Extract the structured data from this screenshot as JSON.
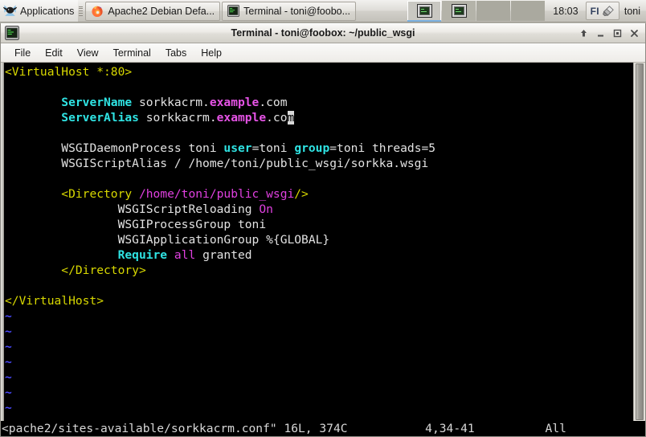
{
  "panel": {
    "apps_menu_label": "Applications",
    "tasks": [
      {
        "label": "Apache2 Debian Defa...",
        "icon": "firefox-icon"
      },
      {
        "label": "Terminal - toni@foobo...",
        "icon": "terminal-icon"
      }
    ],
    "workspaces": [
      {
        "name": "workspace-1",
        "active": true,
        "has_window": true
      },
      {
        "name": "workspace-2",
        "active": false,
        "has_window": true
      },
      {
        "name": "workspace-3",
        "active": false,
        "has_window": false
      },
      {
        "name": "workspace-4",
        "active": false,
        "has_window": false
      }
    ],
    "clock": "18:03",
    "keyboard_layout": "FI",
    "user": "toni"
  },
  "window": {
    "title": "Terminal - toni@foobox: ~/public_wsgi",
    "buttons": {
      "shade": "shade-window",
      "minimize": "minimize-window",
      "maximize": "maximize-window",
      "close": "close-window"
    },
    "menus": [
      {
        "label": "File"
      },
      {
        "label": "Edit"
      },
      {
        "label": "View"
      },
      {
        "label": "Terminal"
      },
      {
        "label": "Tabs"
      },
      {
        "label": "Help"
      }
    ]
  },
  "editor": {
    "file_text": "<VirtualHost *:80>\n\n        ServerName sorkkacrm.example.com\n        ServerAlias sorkkacrm.example.com\n\n        WSGIDaemonProcess toni user=toni group=toni threads=5\n        WSGIScriptAlias / /home/toni/public_wsgi/sorkka.wsgi\n\n        <Directory /home/toni/public_wsgi/>\n                WSGIScriptReloading On\n                WSGIProcessGroup toni\n                WSGIApplicationGroup %{GLOBAL}\n                Require all granted\n        </Directory>\n\n</VirtualHost>",
    "lines": [
      {
        "n": 1,
        "text": "<VirtualHost *:80>"
      },
      {
        "n": 2,
        "text": ""
      },
      {
        "n": 3,
        "text": "        ServerName sorkkacrm.example.com"
      },
      {
        "n": 4,
        "text": "        ServerAlias sorkkacrm.example.com"
      },
      {
        "n": 5,
        "text": ""
      },
      {
        "n": 6,
        "text": "        WSGIDaemonProcess toni user=toni group=toni threads=5"
      },
      {
        "n": 7,
        "text": "        WSGIScriptAlias / /home/toni/public_wsgi/sorkka.wsgi"
      },
      {
        "n": 8,
        "text": ""
      },
      {
        "n": 9,
        "text": "        <Directory /home/toni/public_wsgi/>"
      },
      {
        "n": 10,
        "text": "                WSGIScriptReloading On"
      },
      {
        "n": 11,
        "text": "                WSGIProcessGroup toni"
      },
      {
        "n": 12,
        "text": "                WSGIApplicationGroup %{GLOBAL}"
      },
      {
        "n": 13,
        "text": "                Require all granted"
      },
      {
        "n": 14,
        "text": "        </Directory>"
      },
      {
        "n": 15,
        "text": ""
      },
      {
        "n": 16,
        "text": "</VirtualHost>"
      }
    ],
    "empty_marker": "~",
    "empty_marker_count": 7,
    "cursor": {
      "line": 4,
      "col": 34,
      "on_char": "m"
    },
    "statusline": {
      "file": "<pache2/sites-available/sorkkacrm.conf\"",
      "size": "16L, 374C",
      "position": "4,34-41",
      "scroll": "All"
    }
  },
  "colors": {
    "terminal_bg": "#000000",
    "terminal_fg": "#d8d8d8",
    "tag_yellow": "#d8d800",
    "directive_cyan": "#00d8d8",
    "value_magenta": "#e040e0",
    "tilde_blue": "#4a4aff",
    "cursor_block": "#d8d8d8",
    "panel_bg": "#dedcd7"
  }
}
